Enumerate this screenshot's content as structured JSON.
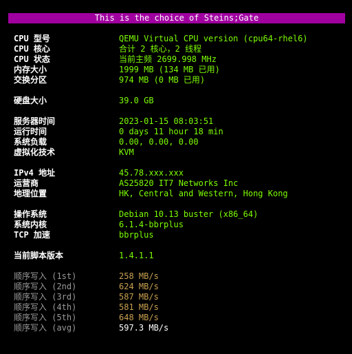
{
  "banner": "This is the choice of Steins;Gate",
  "colors": {
    "background": "#000000",
    "banner": "#a000a0",
    "label": "#ffffff",
    "value": "#7cfc00",
    "io_label": "#9a9a9a",
    "io_value": "#c8a050",
    "io_avg": "#ffffff"
  },
  "cpu": {
    "model_label": "CPU 型号",
    "model_value": "QEMU Virtual CPU version (cpu64-rhel6)",
    "cores_label": "CPU 核心",
    "cores_value": "合计 2 核心，2 线程",
    "status_label": "CPU 状态",
    "status_value": "当前主频 2699.998 MHz"
  },
  "memory": {
    "ram_label": "内存大小",
    "ram_value": "1999 MB (134 MB 已用)",
    "swap_label": "交换分区",
    "swap_value": "974 MB (0 MB 已用)"
  },
  "disk": {
    "label": "硬盘大小",
    "value": "39.0 GB"
  },
  "system": {
    "time_label": "服务器时间",
    "time_value": "2023-01-15 08:03:51",
    "uptime_label": "运行时间",
    "uptime_value": "0 days 11 hour 18 min",
    "load_label": "系统负载",
    "load_value": "0.00, 0.00, 0.00",
    "virt_label": "虚拟化技术",
    "virt_value": "KVM"
  },
  "network": {
    "ipv4_label": "IPv4 地址",
    "ipv4_value": "45.78.xxx.xxx",
    "isp_label": "运营商",
    "isp_value": "AS25820 IT7 Networks Inc",
    "location_label": "地理位置",
    "location_value": "HK, Central and Western, Hong Kong"
  },
  "os": {
    "os_label": "操作系统",
    "os_value": "Debian 10.13 buster (x86_64)",
    "kernel_label": "系统内核",
    "kernel_value": "6.1.4-bbrplus",
    "tcp_label": "TCP 加速",
    "tcp_value": "bbrplus"
  },
  "script": {
    "version_label": "当前脚本版本",
    "version_value": "1.4.1.1"
  },
  "io": [
    {
      "label": "顺序写入 (1st)",
      "value": "258 MB/s"
    },
    {
      "label": "顺序写入 (2nd)",
      "value": "624 MB/s"
    },
    {
      "label": "顺序写入 (3rd)",
      "value": "587 MB/s"
    },
    {
      "label": "顺序写入 (4th)",
      "value": "581 MB/s"
    },
    {
      "label": "顺序写入 (5th)",
      "value": "648 MB/s"
    },
    {
      "label": "顺序写入 (avg)",
      "value": "597.3 MB/s"
    }
  ]
}
